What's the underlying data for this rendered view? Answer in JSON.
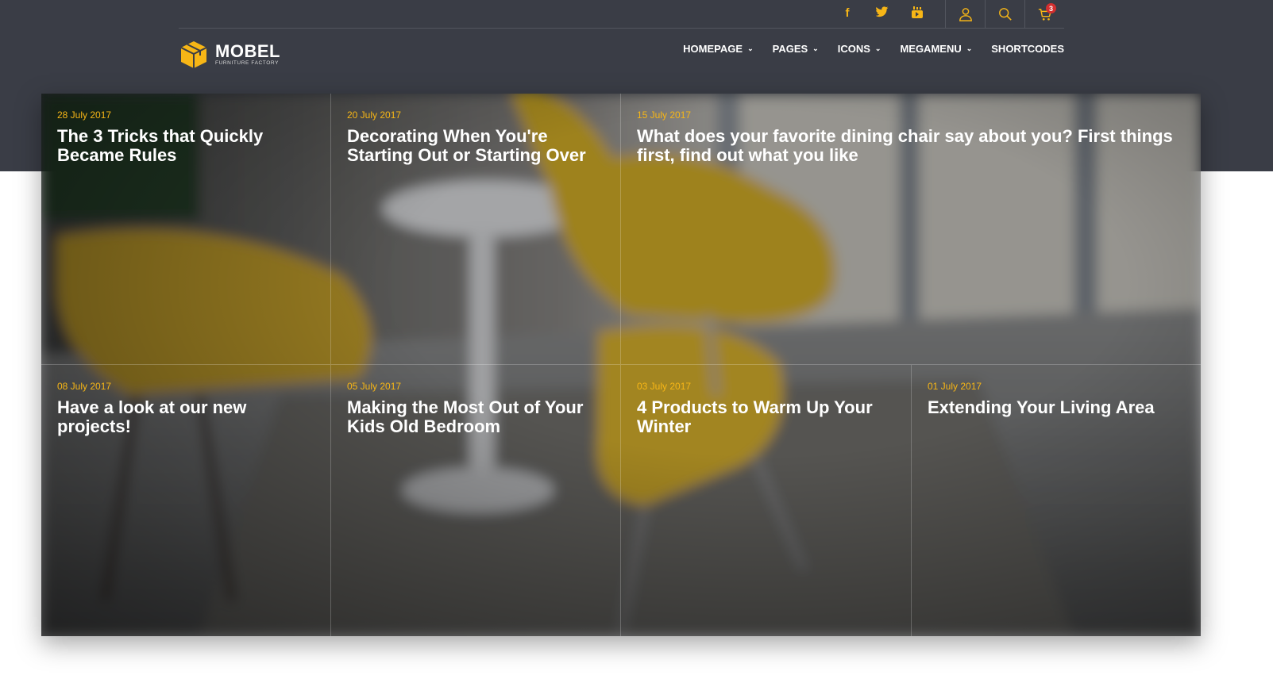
{
  "brand": {
    "name": "MOBEL",
    "tagline": "FURNITURE FACTORY",
    "accent_color": "#f7b616",
    "header_color": "#3a3d46"
  },
  "social": [
    {
      "name": "facebook-icon",
      "glyph": "f"
    },
    {
      "name": "twitter-icon",
      "glyph": "t"
    },
    {
      "name": "youtube-icon",
      "glyph": "▶"
    }
  ],
  "utility": {
    "cart_count": "3"
  },
  "nav": {
    "items": [
      {
        "label": "HOMEPAGE",
        "has_dropdown": true
      },
      {
        "label": "PAGES",
        "has_dropdown": true
      },
      {
        "label": "ICONS",
        "has_dropdown": true
      },
      {
        "label": "MEGAMENU",
        "has_dropdown": true
      },
      {
        "label": "SHORTCODES",
        "has_dropdown": false
      }
    ]
  },
  "posts": [
    {
      "date": "28 July 2017",
      "title": "The 3 Tricks that Quickly Became Rules"
    },
    {
      "date": "20 July 2017",
      "title": "Decorating When You're Starting Out or Starting Over"
    },
    {
      "date": "15 July 2017",
      "title": "What does your favorite dining chair say about you? First things first, find out what you like"
    },
    {
      "date": "08 July 2017",
      "title": "Have a look at our new projects!"
    },
    {
      "date": "05 July 2017",
      "title": "Making the Most Out of Your Kids Old Bedroom"
    },
    {
      "date": "03 July 2017",
      "title": "4 Products to Warm Up Your Winter"
    },
    {
      "date": "01 July 2017",
      "title": "Extending Your Living Area"
    }
  ]
}
